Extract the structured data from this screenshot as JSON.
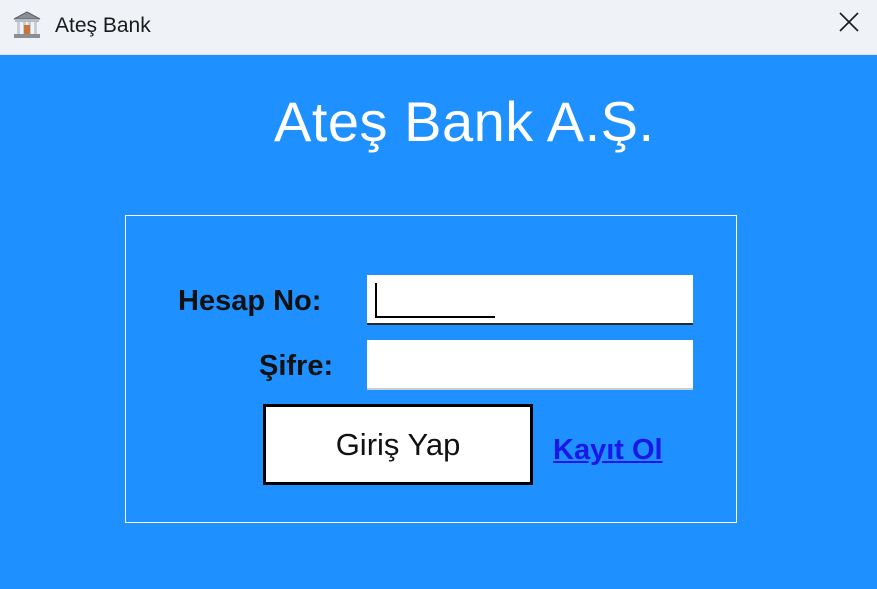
{
  "window": {
    "title": "Ateş Bank",
    "icon": "bank-icon",
    "close_icon": "close-icon"
  },
  "main": {
    "heading": "Ateş Bank A.Ş.",
    "form": {
      "account_label": "Hesap No:",
      "account_value": "",
      "password_label": "Şifre:",
      "password_value": "",
      "login_button": "Giriş Yap",
      "register_link": "Kayıt Ol"
    }
  },
  "colors": {
    "background": "#1e90ff",
    "titlebar": "#eff3f8",
    "link": "#1b17e8",
    "heading": "#ffffff"
  }
}
